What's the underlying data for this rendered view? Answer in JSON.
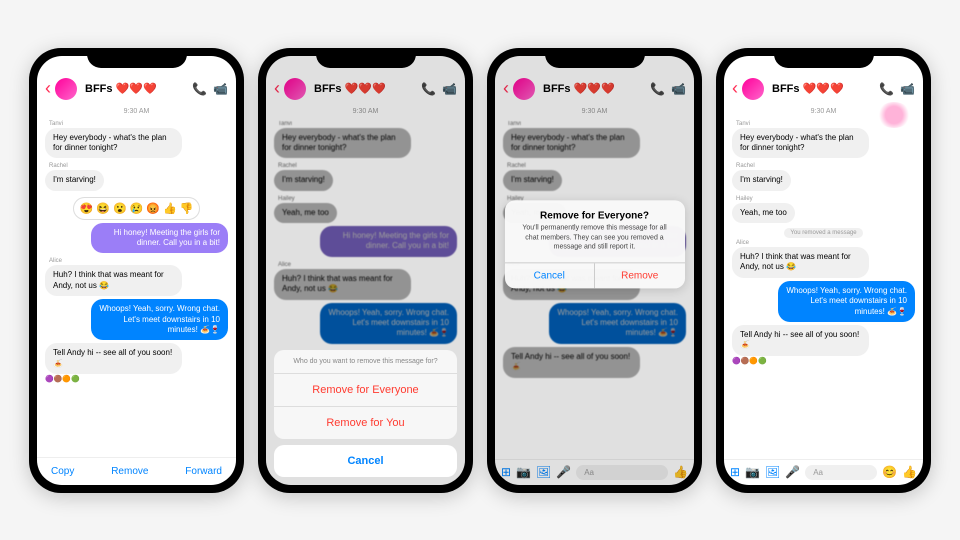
{
  "chatTitle": "BFFs",
  "hearts": "❤️❤️❤️",
  "timestamp": "9:30 AM",
  "msgs": {
    "tanvi": "Tanvi",
    "m1": "Hey everybody - what's the plan for dinner tonight?",
    "rachel": "Rachel",
    "m2": "I'm starving!",
    "hailey": "Hailey",
    "m3": "Yeah, me too",
    "meP": "Hi honey! Meeting the girls for dinner. Call you in a bit!",
    "alice": "Alice",
    "m4": "Huh? I think that was meant for Andy, not us 😂",
    "meB": "Whoops! Yeah, sorry. Wrong chat. Let's meet downstairs in 10 minutes! 🍝🍷",
    "m5": "Tell Andy hi -- see all of you soon! 🍝"
  },
  "reactions": [
    "😍",
    "😆",
    "😮",
    "😢",
    "😡",
    "👍",
    "👎"
  ],
  "footerActions": {
    "copy": "Copy",
    "remove": "Remove",
    "forward": "Forward"
  },
  "sheet": {
    "prompt": "Who do you want to remove this message for?",
    "everyone": "Remove for Everyone",
    "you": "Remove for You",
    "cancel": "Cancel"
  },
  "alert": {
    "title": "Remove for Everyone?",
    "body": "You'll permanently remove this message for all chat members. They can see you removed a message and still report it.",
    "cancel": "Cancel",
    "remove": "Remove"
  },
  "removedNotice": "You removed a message",
  "inputPlaceholder": "Aa"
}
